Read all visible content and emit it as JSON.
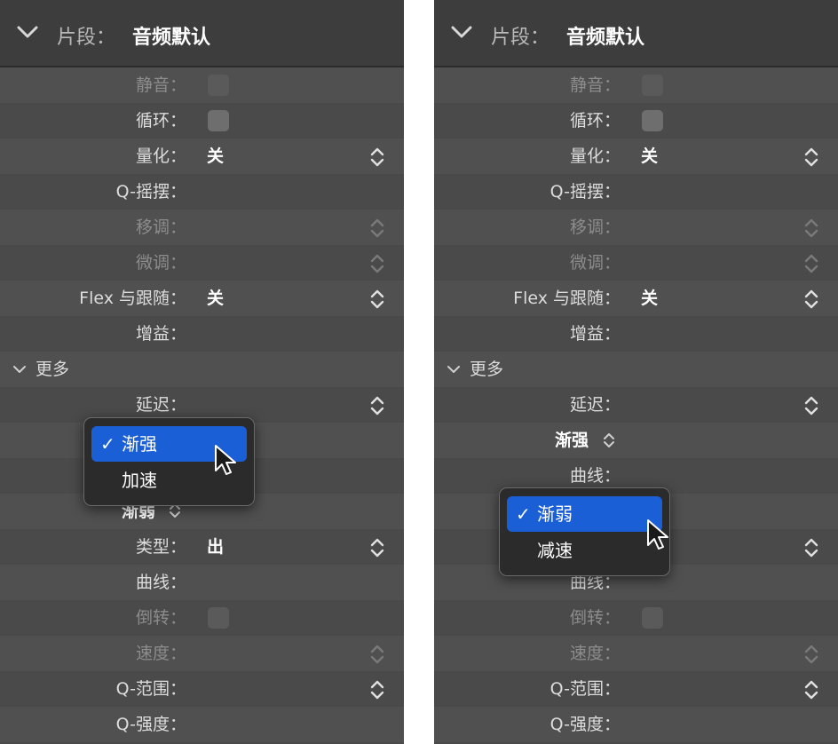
{
  "header": {
    "label": "片段：",
    "title": "音频默认"
  },
  "rows": {
    "mute": "静音：",
    "loop": "循环：",
    "quantize": "量化：",
    "quantize_value": "关",
    "q_swing": "Q-摇摆：",
    "transpose": "移调：",
    "fine_tune": "微调：",
    "flex_follow": "Flex 与跟随：",
    "flex_follow_value": "关",
    "gain": "增益：",
    "more": "更多",
    "delay": "延迟：",
    "curve": "曲线：",
    "type": "类型：",
    "type_value": "出",
    "reverse": "倒转：",
    "speed": "速度：",
    "q_range": "Q-范围：",
    "q_strength": "Q-强度："
  },
  "left_panel": {
    "fade_out_popup": "渐弱",
    "dropdown": {
      "items": [
        {
          "label": "渐强",
          "selected": true
        },
        {
          "label": "加速",
          "selected": false
        }
      ]
    }
  },
  "right_panel": {
    "fade_in_popup": "渐强",
    "dropdown": {
      "items": [
        {
          "label": "渐弱",
          "selected": true
        },
        {
          "label": "减速",
          "selected": false
        }
      ]
    }
  },
  "checkmark": "✓",
  "colors": {
    "panel_bg": "#4a4a4a",
    "header_bg": "#3d3d3d",
    "selection_blue": "#1a5fd6",
    "menu_bg": "#2b2b2b"
  }
}
